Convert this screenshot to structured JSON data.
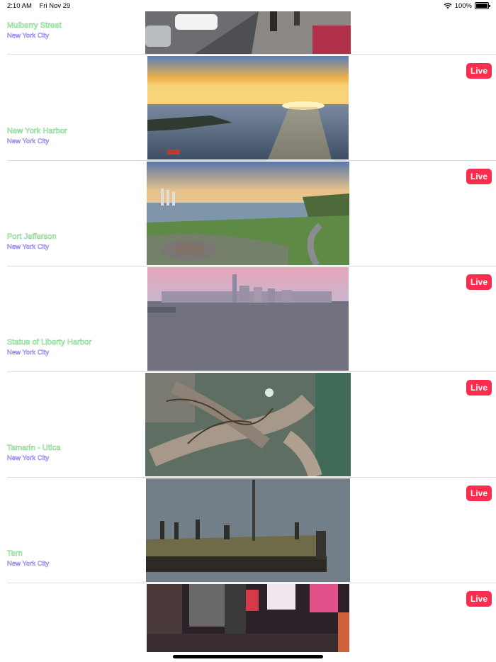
{
  "status_bar": {
    "time": "2:10 AM",
    "date": "Fri Nov 29",
    "battery": "100%",
    "icons": [
      "wifi-icon",
      "battery-icon"
    ]
  },
  "cameras": [
    {
      "title": "Mulberry Street",
      "city": "New York City",
      "live": false
    },
    {
      "title": "New York Harbor",
      "city": "New York City",
      "live": true,
      "live_label": "Live"
    },
    {
      "title": "Port Jefferson",
      "city": "New York City",
      "live": true,
      "live_label": "Live"
    },
    {
      "title": "Statue of Liberty Harbor",
      "city": "New York City",
      "live": true,
      "live_label": "Live"
    },
    {
      "title": "Tamarin - Utica",
      "city": "New York City",
      "live": true,
      "live_label": "Live"
    },
    {
      "title": "Tern",
      "city": "New York City",
      "live": true,
      "live_label": "Live"
    },
    {
      "title": "",
      "city": "",
      "live": true,
      "live_label": "Live"
    }
  ],
  "colors": {
    "title_outline": "#79d685",
    "city_outline": "#7b72e8",
    "live_badge": "#fa2d4e",
    "divider": "#dcdcdc"
  }
}
